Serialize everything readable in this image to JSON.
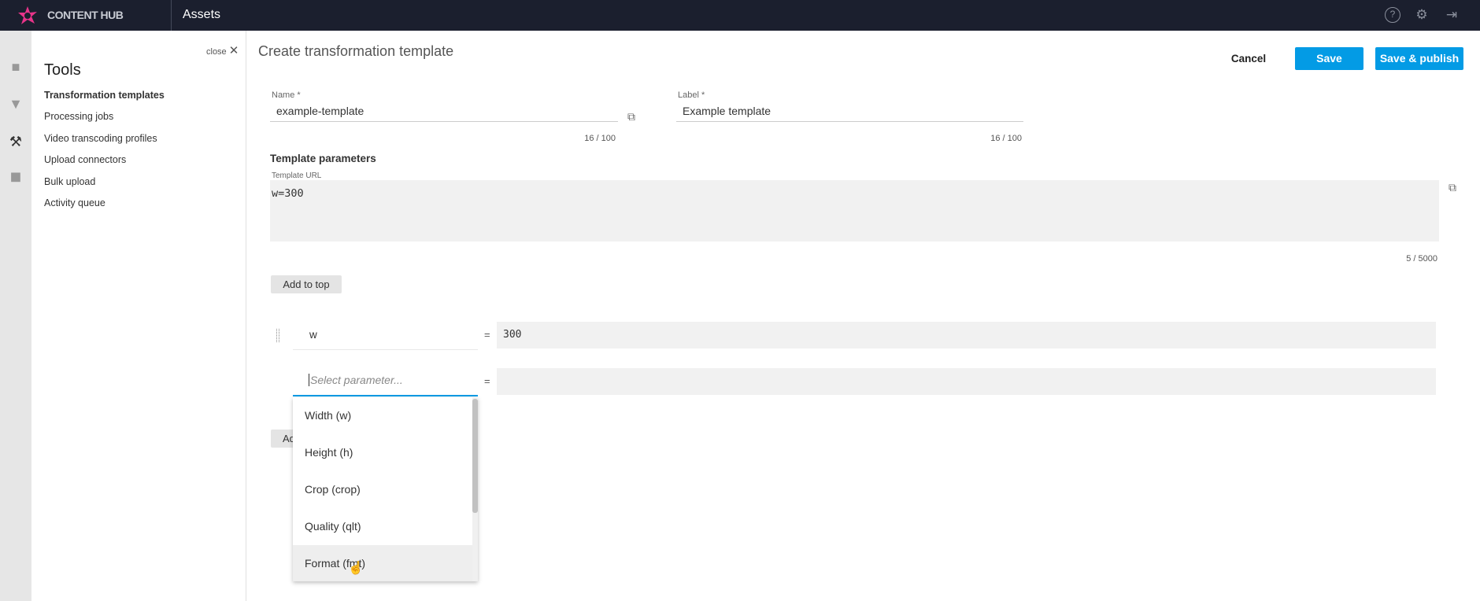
{
  "header": {
    "logo_text": "CONTENT HUB",
    "section": "Assets",
    "icons": [
      "help-icon",
      "settings-icon",
      "logout-icon"
    ],
    "bg": "#1b1f2e"
  },
  "icon_strip": [
    "folder-icon",
    "filter-icon",
    "tools-icon",
    "box-icon"
  ],
  "tools_panel": {
    "close_label": "close",
    "title": "Tools",
    "items": [
      {
        "label": "Transformation templates",
        "active": true
      },
      {
        "label": "Processing jobs"
      },
      {
        "label": "Video transcoding profiles"
      },
      {
        "label": "Upload connectors"
      },
      {
        "label": "Bulk upload"
      },
      {
        "label": "Activity queue"
      }
    ]
  },
  "main": {
    "title": "Create transformation template",
    "actions": {
      "cancel": "Cancel",
      "save": "Save",
      "save_publish": "Save & publish",
      "accent": "#039be5"
    },
    "name": {
      "label": "Name *",
      "value": "example-template",
      "counter": "16 / 100"
    },
    "label_field": {
      "label": "Label *",
      "value": "Example template",
      "counter": "16 / 100"
    },
    "params_heading": "Template parameters",
    "url": {
      "label": "Template URL",
      "value": "w=300",
      "counter": "5 / 5000"
    },
    "add_top": "Add to top",
    "rows": [
      {
        "key": "w",
        "eq": "=",
        "value": "300"
      },
      {
        "placeholder": "Select parameter...",
        "eq": "=",
        "value": ""
      }
    ],
    "add_bottom": "Ad",
    "dropdown": {
      "options": [
        "Width (w)",
        "Height (h)",
        "Crop (crop)",
        "Quality (qlt)",
        "Format (fmt)"
      ],
      "hovered": "Format (fmt)"
    }
  }
}
